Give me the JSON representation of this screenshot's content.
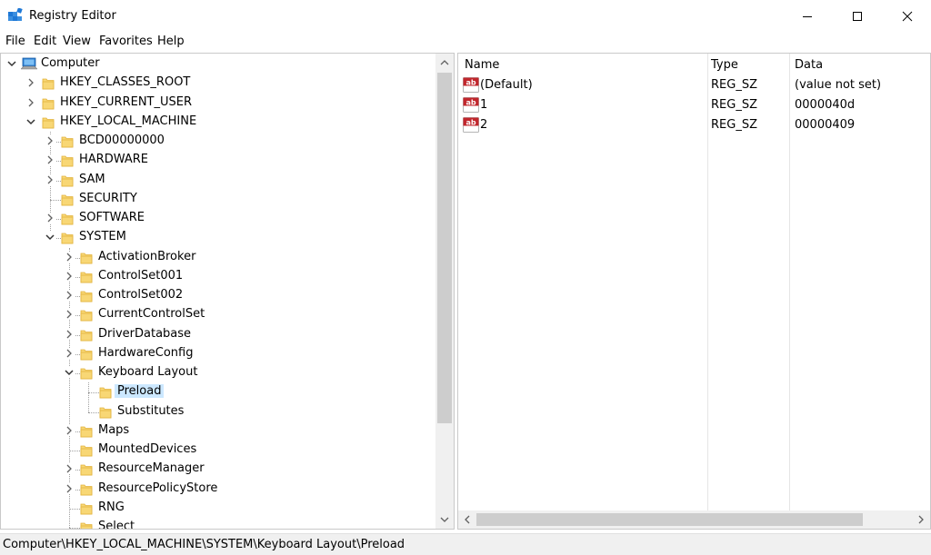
{
  "window": {
    "title": "Registry Editor",
    "icons": {
      "app": "registry-editor-icon",
      "minimize": "minimize-icon",
      "maximize": "maximize-icon",
      "close": "close-icon"
    }
  },
  "menu": [
    "File",
    "Edit",
    "View",
    "Favorites",
    "Help"
  ],
  "tree": [
    {
      "label": "Computer",
      "expander": "expanded",
      "icon": "computer-icon"
    },
    {
      "label": "HKEY_CLASSES_ROOT",
      "expander": "collapsed",
      "icon": "folder-icon"
    },
    {
      "label": "HKEY_CURRENT_USER",
      "expander": "collapsed",
      "icon": "folder-icon"
    },
    {
      "label": "HKEY_LOCAL_MACHINE",
      "expander": "expanded",
      "icon": "folder-icon"
    },
    {
      "label": "BCD00000000",
      "expander": "collapsed",
      "icon": "folder-icon"
    },
    {
      "label": "HARDWARE",
      "expander": "collapsed",
      "icon": "folder-icon"
    },
    {
      "label": "SAM",
      "expander": "collapsed",
      "icon": "folder-icon"
    },
    {
      "label": "SECURITY",
      "expander": "none",
      "icon": "folder-icon"
    },
    {
      "label": "SOFTWARE",
      "expander": "collapsed",
      "icon": "folder-icon"
    },
    {
      "label": "SYSTEM",
      "expander": "expanded",
      "icon": "folder-icon"
    },
    {
      "label": "ActivationBroker",
      "expander": "collapsed",
      "icon": "folder-icon"
    },
    {
      "label": "ControlSet001",
      "expander": "collapsed",
      "icon": "folder-icon"
    },
    {
      "label": "ControlSet002",
      "expander": "collapsed",
      "icon": "folder-icon"
    },
    {
      "label": "CurrentControlSet",
      "expander": "collapsed",
      "icon": "folder-icon"
    },
    {
      "label": "DriverDatabase",
      "expander": "collapsed",
      "icon": "folder-icon"
    },
    {
      "label": "HardwareConfig",
      "expander": "collapsed",
      "icon": "folder-icon"
    },
    {
      "label": "Keyboard Layout",
      "expander": "expanded",
      "icon": "folder-icon"
    },
    {
      "label": "Preload",
      "expander": "none",
      "icon": "folder-icon",
      "selected": true
    },
    {
      "label": "Substitutes",
      "expander": "none",
      "icon": "folder-icon"
    },
    {
      "label": "Maps",
      "expander": "collapsed",
      "icon": "folder-icon"
    },
    {
      "label": "MountedDevices",
      "expander": "none",
      "icon": "folder-icon"
    },
    {
      "label": "ResourceManager",
      "expander": "collapsed",
      "icon": "folder-icon"
    },
    {
      "label": "ResourcePolicyStore",
      "expander": "collapsed",
      "icon": "folder-icon"
    },
    {
      "label": "RNG",
      "expander": "none",
      "icon": "folder-icon"
    },
    {
      "label": "Select",
      "expander": "none",
      "icon": "folder-icon"
    }
  ],
  "list": {
    "columns": [
      "Name",
      "Type",
      "Data"
    ],
    "rows": [
      {
        "name": "(Default)",
        "type": "REG_SZ",
        "data": "(value not set)",
        "icon": "string-value-icon"
      },
      {
        "name": "1",
        "type": "REG_SZ",
        "data": "0000040d",
        "icon": "string-value-icon"
      },
      {
        "name": "2",
        "type": "REG_SZ",
        "data": "00000409",
        "icon": "string-value-icon"
      }
    ]
  },
  "status": {
    "path": "Computer\\HKEY_LOCAL_MACHINE\\SYSTEM\\Keyboard Layout\\Preload"
  },
  "colors": {
    "selection": "#cce8ff",
    "folder": "#f8d775",
    "folder_dark": "#e2b33c",
    "scrollbar_track": "#f0f0f0",
    "scrollbar_thumb": "#cdcdcd",
    "value_icon_red": "#c1272d"
  }
}
